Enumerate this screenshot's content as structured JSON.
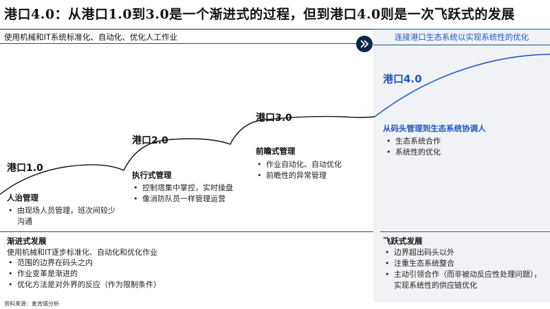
{
  "title": "港口4.0：从港口1.0到3.0是一个渐进式的过程，但到港口4.0则是一次飞跃式的发展",
  "left_header": "使用机械和IT系统标准化、自动化、优化人工作业",
  "right_header": "连接港口生态系统以实现系统性的优化",
  "ports": [
    {
      "label": "港口1.0",
      "mgmt": "人治管理",
      "points": [
        "由现场人员管理，班次间较少沟通"
      ]
    },
    {
      "label": "港口2.0",
      "mgmt": "执行式管理",
      "points": [
        "控制塔集中掌控，实时操盘",
        "像消防队员一样管理运营"
      ]
    },
    {
      "label": "港口3.0",
      "mgmt": "前瞻式管理",
      "points": [
        "作业自动化、自动优化",
        "前瞻性的异常管理"
      ]
    },
    {
      "label": "港口4.0",
      "mgmt": "从码头管理到生态系统协调人",
      "points": [
        "生态系统合作",
        "系统性的优化"
      ]
    }
  ],
  "gradual": {
    "title": "渐进式发展",
    "intro": "使用机械和IT逐步标准化、自动化和优化作业",
    "points": [
      "范围的边界在码头之内",
      "作业变革是渐进的",
      "优化方法是对外界的反应（作为限制条件）"
    ]
  },
  "leap": {
    "title": "飞跃式发展",
    "points": [
      "边界超出码头以外",
      "注重生态系统整合",
      "主动引领合作（而非被动反应性处理问题），实现系统性的供应链优化"
    ]
  },
  "source": "资料来源：麦肯锡分析",
  "colors": {
    "accent": "#1f55c4",
    "dark_navy": "#0d2548",
    "panel_bg": "#f0f2f5"
  },
  "icons": {
    "arrow": "double-chevron-right-icon"
  }
}
